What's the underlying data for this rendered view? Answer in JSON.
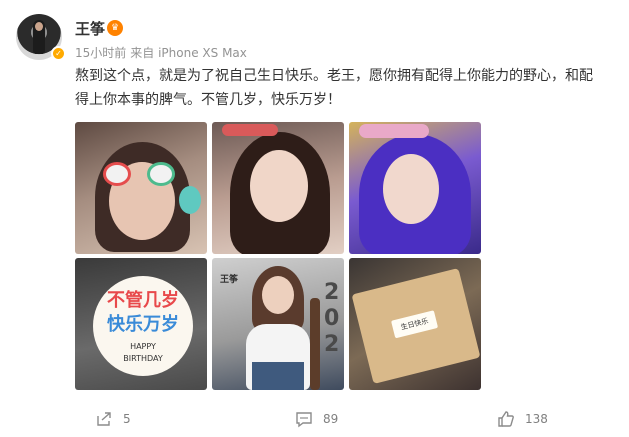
{
  "post": {
    "username": "王筝",
    "meta_time": "15小时前",
    "meta_source": "来自 iPhone XS Max",
    "text": "熬到这个点，就是为了祝自己生日快乐。老王，愿你拥有配得上你能力的野心，和配得上你本事的脾气。不管几岁，快乐万岁！"
  },
  "photos": {
    "p4_cake_line1": "不管几岁",
    "p4_cake_line2": "快乐万岁",
    "p4_cake_line3": "HAPPY",
    "p4_cake_line4": "BIRTHDAY",
    "p5_name": "王筝",
    "p6_plaque": "生日快乐"
  },
  "actions": {
    "share_count": "5",
    "comment_count": "89",
    "like_count": "138"
  },
  "icons": {
    "share": "share-icon",
    "comment": "comment-icon",
    "like": "thumbs-up-icon",
    "verified": "verified-badge-icon",
    "vip": "vip-badge-icon"
  },
  "colors": {
    "accent": "#ff8200",
    "meta_gray": "#939393",
    "action_gray": "#808080"
  }
}
